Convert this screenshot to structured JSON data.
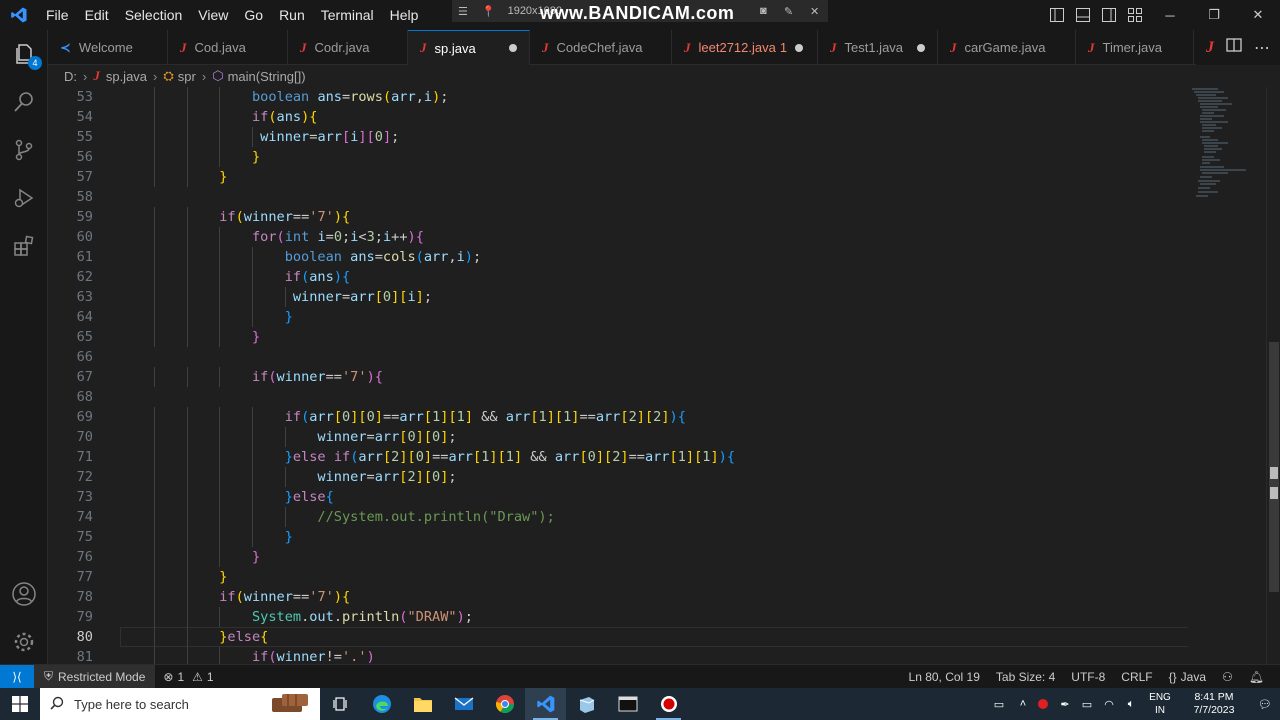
{
  "menu": [
    "File",
    "Edit",
    "Selection",
    "View",
    "Go",
    "Run",
    "Terminal",
    "Help"
  ],
  "recorder": {
    "resolution": "1920x1080",
    "brand": "www.BANDICAM.com"
  },
  "activity": {
    "explorer_badge": "4"
  },
  "tabs": [
    {
      "label": "Welcome",
      "kind": "welcome",
      "state": ""
    },
    {
      "label": "Cod.java",
      "kind": "java",
      "state": ""
    },
    {
      "label": "Codr.java",
      "kind": "java",
      "state": ""
    },
    {
      "label": "sp.java",
      "kind": "java",
      "state": "dirty",
      "active": true
    },
    {
      "label": "CodeChef.java",
      "kind": "java",
      "state": ""
    },
    {
      "label": "leet2712.java",
      "kind": "java",
      "state": "dirty",
      "errors": "1"
    },
    {
      "label": "Test1.java",
      "kind": "java",
      "state": "dirty"
    },
    {
      "label": "carGame.java",
      "kind": "java",
      "state": ""
    },
    {
      "label": "Timer.java",
      "kind": "java",
      "state": ""
    }
  ],
  "breadcrumb": {
    "drive": "D:",
    "file": "sp.java",
    "class": "spr",
    "method": "main(String[])"
  },
  "editor": {
    "current_line": 80,
    "lines": [
      {
        "n": 53,
        "t": "                boolean ans=rows(arr,i);"
      },
      {
        "n": 54,
        "t": "                if(ans){"
      },
      {
        "n": 55,
        "t": "                 winner=arr[i][0];"
      },
      {
        "n": 56,
        "t": "                }"
      },
      {
        "n": 57,
        "t": "            }"
      },
      {
        "n": 58,
        "t": ""
      },
      {
        "n": 59,
        "t": "            if(winner=='7'){"
      },
      {
        "n": 60,
        "t": "                for(int i=0;i<3;i++){"
      },
      {
        "n": 61,
        "t": "                    boolean ans=cols(arr,i);"
      },
      {
        "n": 62,
        "t": "                    if(ans){"
      },
      {
        "n": 63,
        "t": "                     winner=arr[0][i];"
      },
      {
        "n": 64,
        "t": "                    }"
      },
      {
        "n": 65,
        "t": "                }"
      },
      {
        "n": 66,
        "t": ""
      },
      {
        "n": 67,
        "t": "                if(winner=='7'){"
      },
      {
        "n": 68,
        "t": ""
      },
      {
        "n": 69,
        "t": "                    if(arr[0][0]==arr[1][1] && arr[1][1]==arr[2][2]){"
      },
      {
        "n": 70,
        "t": "                        winner=arr[0][0];"
      },
      {
        "n": 71,
        "t": "                    }else if(arr[2][0]==arr[1][1] && arr[0][2]==arr[1][1]){"
      },
      {
        "n": 72,
        "t": "                        winner=arr[2][0];"
      },
      {
        "n": 73,
        "t": "                    }else{"
      },
      {
        "n": 74,
        "t": "                        //System.out.println(\"Draw\");"
      },
      {
        "n": 75,
        "t": "                    }"
      },
      {
        "n": 76,
        "t": "                }"
      },
      {
        "n": 77,
        "t": "            }"
      },
      {
        "n": 78,
        "t": "            if(winner=='7'){"
      },
      {
        "n": 79,
        "t": "                System.out.println(\"DRAW\");"
      },
      {
        "n": 80,
        "t": "            }else{"
      },
      {
        "n": 81,
        "t": "                if(winner!='.')"
      }
    ]
  },
  "status": {
    "remote_icon": "remote-icon",
    "restricted": "Restricted Mode",
    "errors": "1",
    "warnings": "1",
    "position": "Ln 80, Col 19",
    "tab_size": "Tab Size: 4",
    "encoding": "UTF-8",
    "eol": "CRLF",
    "language": "Java"
  },
  "taskbar": {
    "search_placeholder": "Type here to search",
    "lang_top": "ENG",
    "lang_bottom": "IN",
    "time": "8:41 PM",
    "date": "7/7/2023"
  },
  "colors": {
    "accent": "#0078d4",
    "java_icon": "#e53935",
    "taskbar": "#1c2833"
  }
}
